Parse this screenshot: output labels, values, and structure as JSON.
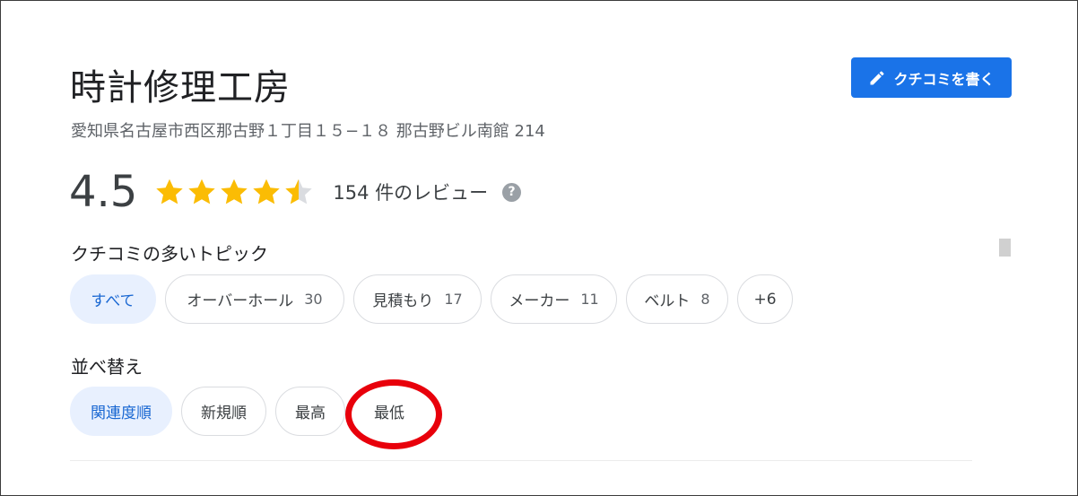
{
  "place": {
    "name": "時計修理工房",
    "address": "愛知県名古屋市西区那古野１丁目１５−１８ 那古野ビル南館 214"
  },
  "write_review": {
    "label": "クチコミを書く",
    "icon": "pencil-icon"
  },
  "rating": {
    "value": "4.5",
    "stars": 4.5,
    "max_stars": 5,
    "review_count": "154 件のレビュー",
    "help_icon_glyph": "?"
  },
  "topics": {
    "heading": "クチコミの多いトピック",
    "chips": [
      {
        "label": "すべて",
        "count": "",
        "selected": true
      },
      {
        "label": "オーバーホール",
        "count": "30",
        "selected": false
      },
      {
        "label": "見積もり",
        "count": "17",
        "selected": false
      },
      {
        "label": "メーカー",
        "count": "11",
        "selected": false
      },
      {
        "label": "ベルト",
        "count": "8",
        "selected": false
      },
      {
        "label": "+6",
        "count": "",
        "selected": false
      }
    ]
  },
  "sort": {
    "heading": "並べ替え",
    "options": [
      {
        "label": "関連度順",
        "selected": true
      },
      {
        "label": "新規順",
        "selected": false
      },
      {
        "label": "最高",
        "selected": false
      },
      {
        "label": "最低",
        "selected": false,
        "highlighted": true
      }
    ]
  },
  "colors": {
    "accent": "#1a73e8",
    "star": "#fbbc04",
    "star_empty": "#dadce0",
    "highlight_ring": "#e8000b",
    "selected_chip_bg": "#e8f0fe",
    "selected_chip_text": "#1967d2"
  }
}
